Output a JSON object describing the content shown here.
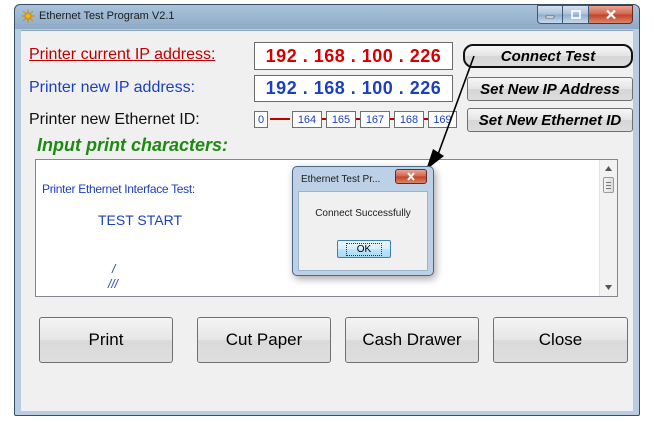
{
  "window": {
    "title": "Ethernet Test Program  V2.1",
    "icon": "app-sun-icon",
    "controls": [
      "minimize-icon",
      "maximize-icon",
      "close-icon"
    ]
  },
  "current_ip": {
    "label": "Printer current IP address:",
    "value": "192 . 168 . 100 . 226",
    "button": "Connect Test"
  },
  "new_ip": {
    "label": "Printer new IP address:",
    "value": "192 . 168 . 100 . 226",
    "button": "Set New IP Address"
  },
  "ethernet_id": {
    "label": "Printer new Ethernet ID:",
    "parts": [
      "0",
      "164",
      "165",
      "167",
      "168",
      "169"
    ],
    "button": "Set New Ethernet ID"
  },
  "input_heading": "Input print characters:",
  "text_area": {
    "line1": "Printer Ethernet Interface Test:",
    "line2": "TEST  START",
    "line3": "/",
    "line4": "///"
  },
  "buttons": [
    "Print",
    "Cut Paper",
    "Cash Drawer",
    "Close"
  ],
  "dialog": {
    "title": "Ethernet Test Pr...",
    "message": "Connect Successfully",
    "ok": "OK"
  },
  "colors": {
    "label_red": "#c00000",
    "label_blue": "#1c3fbf",
    "heading_green": "#1f8a12"
  }
}
